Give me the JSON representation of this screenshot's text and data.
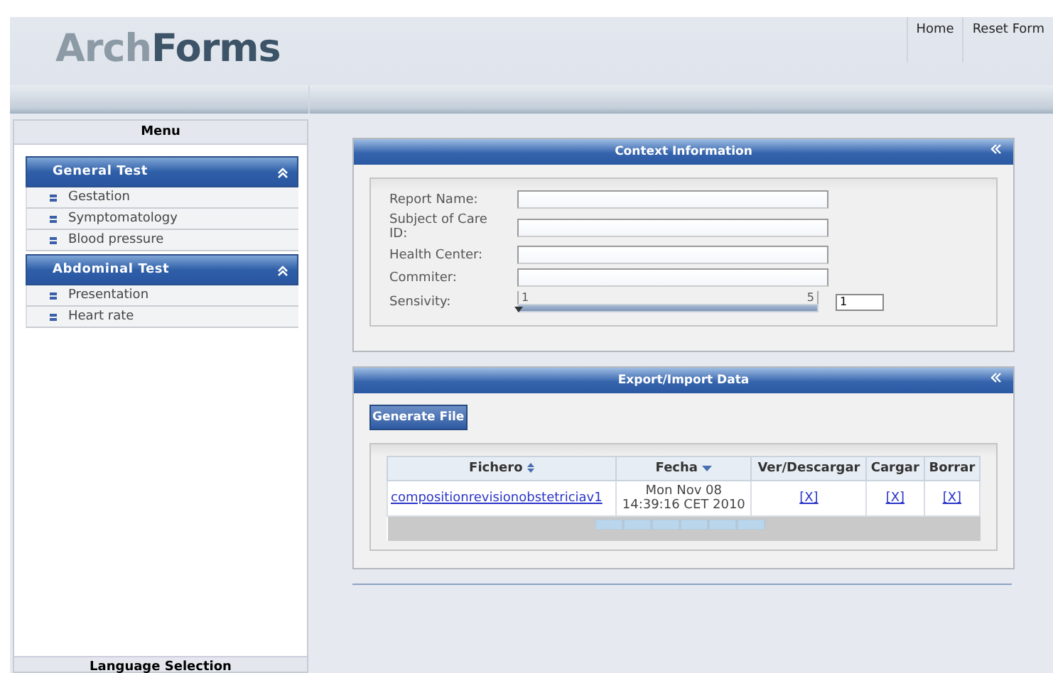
{
  "header": {
    "logo_light": "Arch",
    "logo_dark": "Forms",
    "nav": [
      "Home",
      "Reset Form"
    ]
  },
  "sidebar": {
    "title": "Menu",
    "groups": [
      {
        "title": "General Test",
        "expanded": true,
        "items": [
          "Gestation",
          "Symptomatology",
          "Blood pressure"
        ]
      },
      {
        "title": "Abdominal Test",
        "expanded": true,
        "items": [
          "Presentation",
          "Heart rate"
        ]
      }
    ],
    "footer_title": "Language Selection"
  },
  "context_panel": {
    "title": "Context Information",
    "fields": [
      {
        "label": "Report Name:",
        "kind": "text"
      },
      {
        "label": "Subject of Care ID:",
        "kind": "text"
      },
      {
        "label": "Health Center:",
        "kind": "text"
      },
      {
        "label": "Commiter:",
        "kind": "text"
      },
      {
        "label": "Sensivity:",
        "kind": "slider",
        "min_label": "1",
        "max_label": "5",
        "level": 0,
        "value": "1"
      }
    ]
  },
  "export_panel": {
    "title": "Export/Import Data",
    "button": "Generate File",
    "table": {
      "columns": [
        {
          "label": "Fichero",
          "kind": "sortable"
        },
        {
          "label": "Fecha",
          "kind": "sorted"
        },
        {
          "label": "Ver/Descargar",
          "kind": "plain"
        },
        {
          "label": "Cargar",
          "kind": "plain"
        },
        {
          "label": "Borrar",
          "kind": "plain"
        }
      ],
      "rows": [
        {
          "file": "compositionrevisionobstetriciav1",
          "date_line1": "Mon Nov 08",
          "date_line2": "14:39:16 CET 2010",
          "view": "[X]",
          "load": "[X]",
          "delete": "[X]"
        }
      ]
    }
  }
}
